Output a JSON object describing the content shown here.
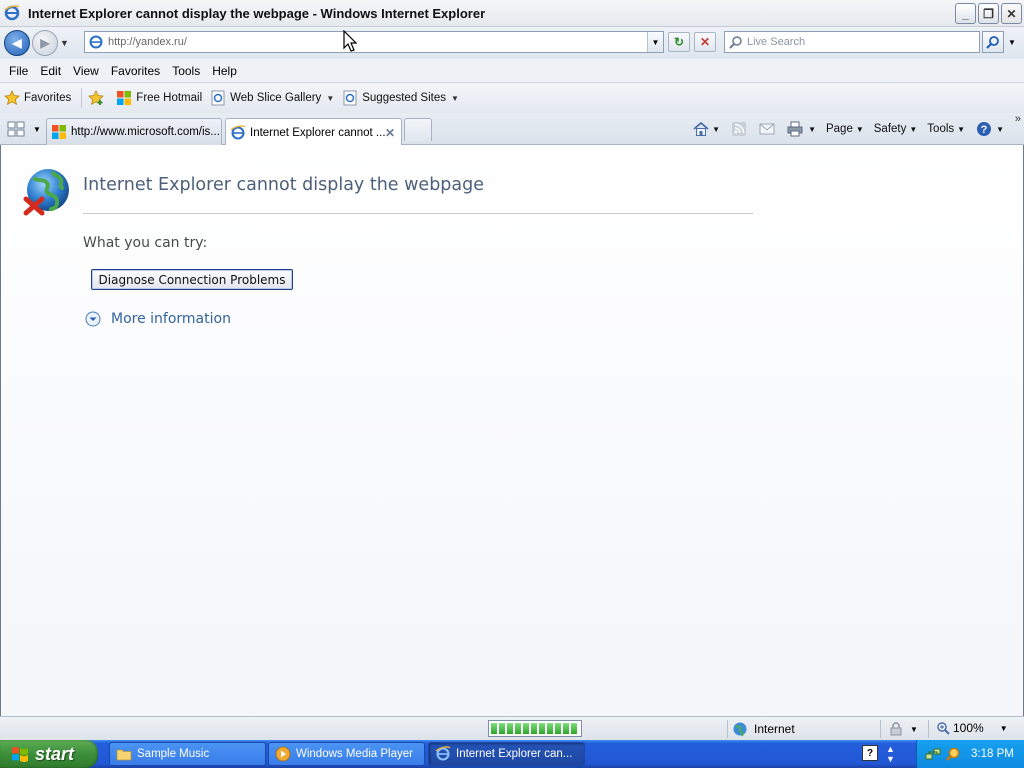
{
  "window": {
    "title": "Internet Explorer cannot display the webpage - Windows Internet Explorer",
    "buttons": [
      "minimize",
      "restore",
      "close"
    ]
  },
  "navigation": {
    "address": "http://yandex.ru/",
    "search_placeholder": "Live Search"
  },
  "menu": {
    "items": [
      "File",
      "Edit",
      "View",
      "Favorites",
      "Tools",
      "Help"
    ]
  },
  "favorites_bar": {
    "favorites_label": "Favorites",
    "links": [
      "Free Hotmail",
      "Web Slice Gallery",
      "Suggested Sites"
    ]
  },
  "tabs": [
    {
      "label": "http://www.microsoft.com/is...",
      "active": false
    },
    {
      "label": "Internet Explorer cannot ...",
      "active": true
    }
  ],
  "command_bar": {
    "page": "Page",
    "safety": "Safety",
    "tools": "Tools"
  },
  "error_page": {
    "title": "Internet Explorer cannot display the webpage",
    "try_label": "What you can try:",
    "diagnose_button": "Diagnose Connection Problems",
    "more_info": "More information"
  },
  "status_bar": {
    "zone": "Internet",
    "zoom": "100%",
    "progress_fraction": 1.0
  },
  "taskbar": {
    "start_label": "start",
    "tasks": [
      {
        "label": "Sample Music",
        "icon": "folder-icon"
      },
      {
        "label": "Windows Media Player",
        "icon": "media-player-icon"
      },
      {
        "label": "Internet Explorer can...",
        "icon": "ie-icon",
        "active": true
      }
    ],
    "clock": "3:18 PM"
  },
  "colors": {
    "taskbar_blue": "#245edb",
    "start_green": "#3c8f3a",
    "error_title": "#4c607a",
    "link_blue": "#34649b"
  }
}
